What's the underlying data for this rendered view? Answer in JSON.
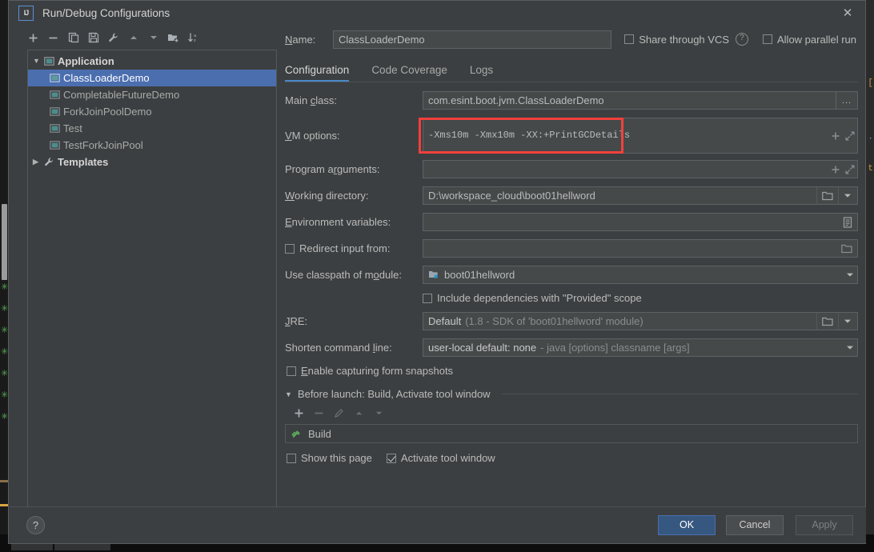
{
  "window": {
    "title": "Run/Debug Configurations",
    "logo_text": "IJ",
    "close_label": "✕"
  },
  "toolbar": {
    "buttons": [
      {
        "name": "add-configuration",
        "icon": "plus-icon",
        "tooltip": "Add New Configuration"
      },
      {
        "name": "remove-configuration",
        "icon": "minus-icon",
        "tooltip": "Remove Configuration"
      },
      {
        "name": "copy-configuration",
        "icon": "copy-icon",
        "tooltip": "Copy Configuration"
      },
      {
        "name": "save-configuration",
        "icon": "save-icon",
        "tooltip": "Save Configuration"
      },
      {
        "name": "edit-templates",
        "icon": "wrench-icon",
        "tooltip": "Edit Templates"
      },
      {
        "name": "move-up",
        "icon": "arrow-up-icon",
        "tooltip": "Move Up"
      },
      {
        "name": "move-down",
        "icon": "arrow-down-icon",
        "tooltip": "Move Down"
      },
      {
        "name": "new-folder",
        "icon": "new-folder-icon",
        "tooltip": "Create New Folder"
      },
      {
        "name": "sort-configurations",
        "icon": "sort-az-icon",
        "tooltip": "Sort Configurations"
      }
    ]
  },
  "tree": {
    "groups": [
      {
        "label": "Application",
        "icon": "application-icon",
        "expanded": true,
        "twisty": "▼",
        "items": [
          {
            "label": "ClassLoaderDemo",
            "selected": true
          },
          {
            "label": "CompletableFutureDemo",
            "selected": false
          },
          {
            "label": "ForkJoinPoolDemo",
            "selected": false
          },
          {
            "label": "Test",
            "selected": false
          },
          {
            "label": "TestForkJoinPool",
            "selected": false
          }
        ]
      },
      {
        "label": "Templates",
        "icon": "wrench-icon",
        "expanded": false,
        "twisty": "▶",
        "items": []
      }
    ]
  },
  "header": {
    "name_label": "Name:",
    "name_value": "ClassLoaderDemo",
    "share_vcs_label": "Share through VCS",
    "share_vcs_checked": false,
    "help_badge": "?",
    "allow_parallel_label": "Allow parallel run",
    "allow_parallel_checked": false
  },
  "tabs": [
    {
      "label": "Configuration",
      "active": true
    },
    {
      "label": "Code Coverage",
      "active": false
    },
    {
      "label": "Logs",
      "active": false
    }
  ],
  "form": {
    "main_class": {
      "label": "Main class:",
      "value": "com.esint.boot.jvm.ClassLoaderDemo",
      "browse_icon": "ellipsis-icon",
      "browse_label": "..."
    },
    "vm_options": {
      "label": "VM options:",
      "value": "-Xms10m -Xmx10m -XX:+PrintGCDetails",
      "macro_icon": "plus-icon",
      "expand_icon": "expand-diagonal-icon",
      "highlighted": true,
      "highlight_color": "#f2403c"
    },
    "program_arguments": {
      "label": "Program arguments:",
      "value": "",
      "macro_icon": "plus-icon",
      "expand_icon": "expand-diagonal-icon"
    },
    "working_directory": {
      "label": "Working directory:",
      "value": "D:\\workspace_cloud\\boot01hellword",
      "browse_icon": "folder-icon",
      "dropdown_icon": "chevron-down-icon"
    },
    "environment_variables": {
      "label": "Environment variables:",
      "value": "",
      "browse_icon": "list-icon"
    },
    "redirect_input": {
      "label": "Redirect input from:",
      "checked": false,
      "value": "",
      "browse_icon": "folder-icon"
    },
    "classpath_module": {
      "label": "Use classpath of module:",
      "value": "boot01hellword",
      "module_icon": "module-icon",
      "dropdown_icon": "chevron-down-icon"
    },
    "include_provided": {
      "label": "Include dependencies with \"Provided\" scope",
      "checked": false
    },
    "jre": {
      "label": "JRE:",
      "value": "Default",
      "hint": "(1.8 - SDK of 'boot01hellword' module)",
      "browse_icon": "folder-icon",
      "dropdown_icon": "chevron-down-icon"
    },
    "shorten_command_line": {
      "label": "Shorten command line:",
      "value": "user-local default: none",
      "hint": "- java [options] classname [args]",
      "dropdown_icon": "chevron-down-icon"
    },
    "form_snapshots": {
      "label": "Enable capturing form snapshots",
      "checked": false
    }
  },
  "before_launch": {
    "twisty": "▼",
    "title": "Before launch: Build, Activate tool window",
    "buttons": [
      {
        "name": "add-task",
        "icon": "plus-icon",
        "enabled": true
      },
      {
        "name": "remove-task",
        "icon": "minus-icon",
        "enabled": false
      },
      {
        "name": "edit-task",
        "icon": "pencil-icon",
        "enabled": false
      },
      {
        "name": "move-task-up",
        "icon": "arrow-up-icon",
        "enabled": false
      },
      {
        "name": "move-task-down",
        "icon": "arrow-down-icon",
        "enabled": false
      }
    ],
    "tasks": [
      {
        "label": "Build",
        "icon": "hammer-icon"
      }
    ],
    "show_this_page": {
      "label": "Show this page",
      "checked": false
    },
    "activate_tool_window": {
      "label": "Activate tool window",
      "checked": true
    }
  },
  "footer": {
    "help_label": "?",
    "ok_label": "OK",
    "cancel_label": "Cancel",
    "apply_label": "Apply",
    "apply_enabled": false
  },
  "colors": {
    "dialog_bg": "#3c3f41",
    "field_bg": "#45494a",
    "selection_blue": "#4b6eaf",
    "accent_blue": "#4a88c7",
    "ok_button": "#365880",
    "annotation_red": "#f2403c",
    "vcs_green": "#53a653"
  }
}
